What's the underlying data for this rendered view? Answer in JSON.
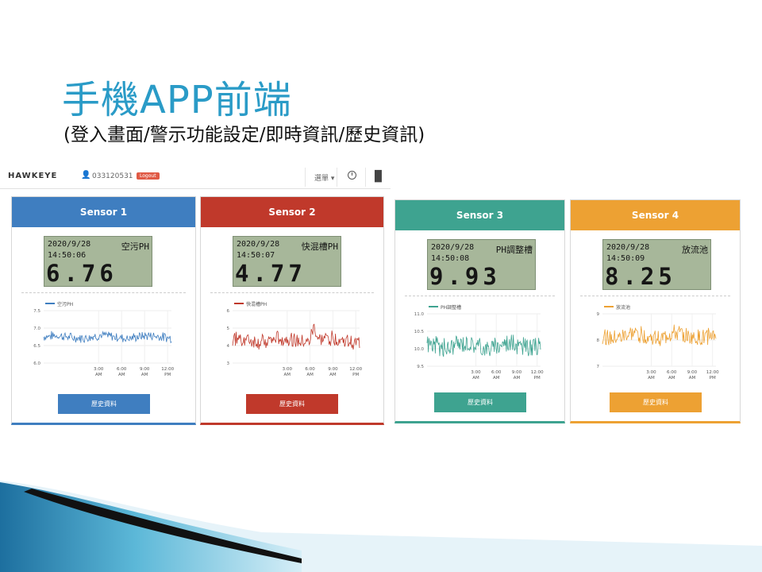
{
  "slide": {
    "title": "手機APP前端",
    "subtitle": "(登入畫面/警示功能設定/即時資訊/歷史資訊)"
  },
  "app": {
    "brand": "HAWKEYE",
    "user_id": "033120531",
    "logout_label": "Logout",
    "menu_label": "選單",
    "icons": {
      "user": "user-icon",
      "clock": "clock-icon",
      "chart": "bar-chart-icon"
    }
  },
  "colors": {
    "blue": "#3f7ec0",
    "red": "#c0392b",
    "teal": "#3ea390",
    "orange": "#eda133",
    "title": "#2a9bc7",
    "lcd": "#a7b79a"
  },
  "sensors": [
    {
      "title": "Sensor 1",
      "date": "2020/9/28",
      "time": "14:50:06",
      "location": "空污PH",
      "value": "6.76",
      "history_button": "歷史資料"
    },
    {
      "title": "Sensor 2",
      "date": "2020/9/28",
      "time": "14:50:07",
      "location": "快混槽PH",
      "value": "4.77",
      "history_button": "歷史資料"
    },
    {
      "title": "Sensor 3",
      "date": "2020/9/28",
      "time": "14:50:08",
      "location": "PH調整槽",
      "value": "9.93",
      "history_button": "歷史資料"
    },
    {
      "title": "Sensor 4",
      "date": "2020/9/28",
      "time": "14:50:09",
      "location": "放流池",
      "value": "8.25",
      "history_button": "歷史資料"
    }
  ],
  "chart_data": [
    {
      "type": "line",
      "series": [
        {
          "name": "空污PH"
        }
      ],
      "y_ticks": [
        "7.5",
        "7.0",
        "6.5",
        "6.0"
      ],
      "ylim": [
        6.0,
        7.5
      ],
      "x_ticks": [
        "3:00 AM",
        "6:00 AM",
        "9:00 AM",
        "12:00 PM"
      ],
      "level": 6.75,
      "amplitude": 0.12,
      "noise": 0.06,
      "grid": true,
      "legend": "top-left"
    },
    {
      "type": "line",
      "series": [
        {
          "name": "快混槽PH"
        }
      ],
      "y_ticks": [
        "6",
        "5",
        "4",
        "3"
      ],
      "ylim": [
        3,
        6
      ],
      "x_ticks": [
        "3:00 AM",
        "6:00 AM",
        "9:00 AM",
        "12:00 PM"
      ],
      "level": 4.3,
      "amplitude": 0.4,
      "noise": 0.15,
      "spike": 5.3,
      "grid": true,
      "legend": "top-left"
    },
    {
      "type": "line",
      "series": [
        {
          "name": "PH調整槽"
        }
      ],
      "y_ticks": [
        "11.0",
        "10.5",
        "10.0",
        "9.5"
      ],
      "ylim": [
        9.5,
        11.0
      ],
      "x_ticks": [
        "3:00 AM",
        "6:00 AM",
        "9:00 AM",
        "12:00 PM"
      ],
      "level": 10.1,
      "amplitude": 0.25,
      "noise": 0.1,
      "grid": true,
      "legend": "top-left"
    },
    {
      "type": "line",
      "series": [
        {
          "name": "放流池"
        }
      ],
      "y_ticks": [
        "9",
        "8",
        "7"
      ],
      "ylim": [
        7,
        9
      ],
      "x_ticks": [
        "3:00 AM",
        "6:00 AM",
        "9:00 AM",
        "12:00 PM"
      ],
      "level": 8.15,
      "amplitude": 0.3,
      "noise": 0.12,
      "grid": true,
      "legend": "top-left"
    }
  ]
}
